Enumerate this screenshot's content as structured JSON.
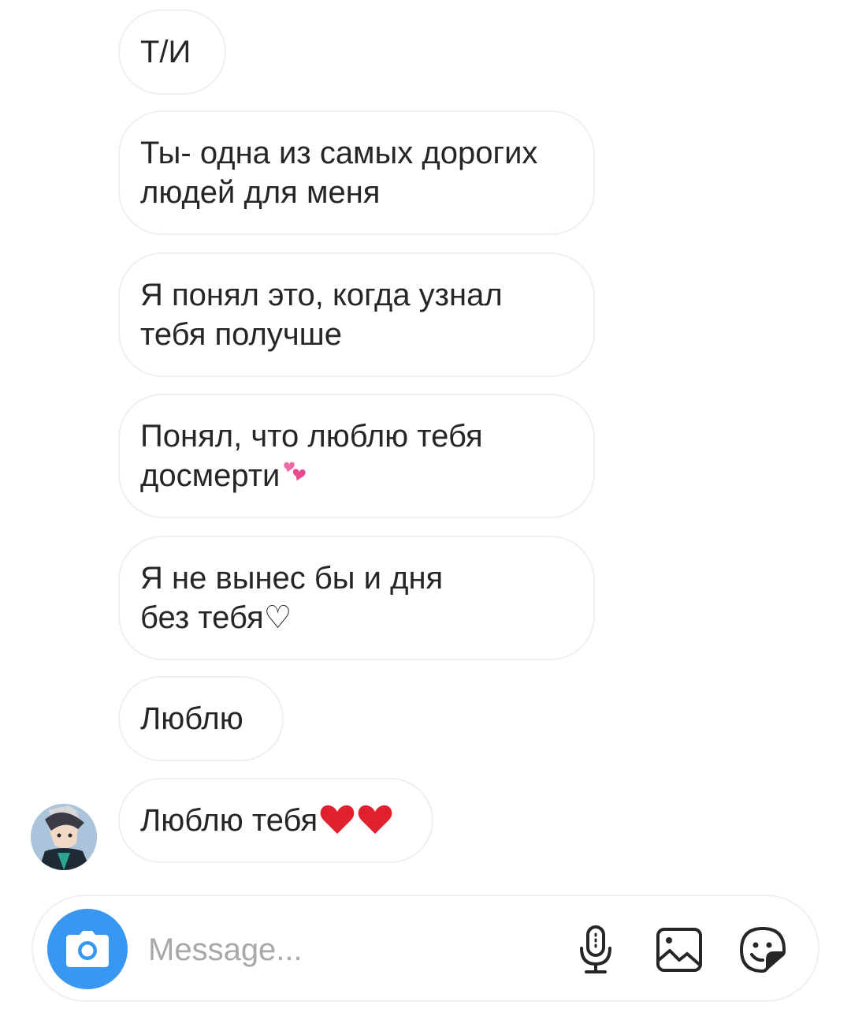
{
  "conversation": {
    "messages": [
      {
        "text": "Т/И"
      },
      {
        "text": "Ты- одна из самых дорогих\nлюдей для меня"
      },
      {
        "text": "Я понял это, когда узнал\nтебя получше"
      },
      {
        "text": "Понял, что люблю тебя\nдосмерти",
        "emoji": "💕"
      },
      {
        "text": "Я не вынес бы и дня\nбез тебя♡"
      },
      {
        "text": "Люблю"
      },
      {
        "text": "Люблю тебя",
        "emoji": "❤️❤️"
      }
    ]
  },
  "composer": {
    "placeholder": "Message..."
  },
  "colors": {
    "accent": "#3897f0",
    "bubble_border": "#efefef",
    "text": "#262626",
    "placeholder": "#a8a8a8",
    "heart_red": "#e0245e",
    "heart_pink": "#f06aa8"
  },
  "icons": [
    "camera-icon",
    "microphone-icon",
    "gallery-icon",
    "sticker-icon"
  ]
}
